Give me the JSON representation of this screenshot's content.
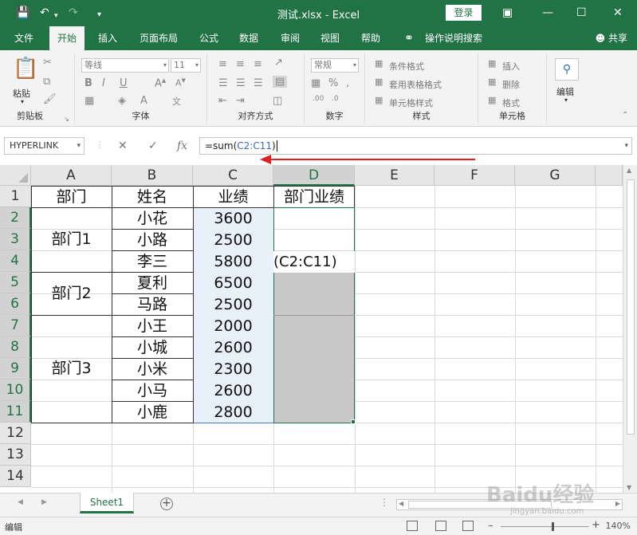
{
  "titlebar": {
    "title": "测试.xlsx  -  Excel",
    "login": "登录",
    "save_icon": "save-icon",
    "undo_icon": "undo-icon",
    "redo_icon": "redo-icon"
  },
  "tabs": [
    {
      "label": "文件"
    },
    {
      "label": "开始"
    },
    {
      "label": "插入"
    },
    {
      "label": "页面布局"
    },
    {
      "label": "公式"
    },
    {
      "label": "数据"
    },
    {
      "label": "审阅"
    },
    {
      "label": "视图"
    },
    {
      "label": "帮助"
    },
    {
      "label": "操作说明搜索"
    }
  ],
  "share": "共享",
  "ribbon": {
    "clipboard": {
      "label": "剪贴板",
      "paste": "粘贴"
    },
    "font": {
      "label": "字体",
      "font_name": "等线",
      "font_size": "11"
    },
    "alignment": {
      "label": "对齐方式"
    },
    "number": {
      "label": "数字",
      "format": "常规"
    },
    "styles": {
      "label": "样式",
      "conditional": "条件格式",
      "table": "套用表格格式",
      "cell": "单元格样式"
    },
    "cells": {
      "label": "单元格",
      "insert": "插入",
      "delete": "删除",
      "format": "格式"
    },
    "editing": {
      "label": "编辑"
    }
  },
  "formula_bar": {
    "name_box": "HYPERLINK",
    "formula_prefix": "=sum(",
    "formula_ref": "C2:C11",
    "formula_suffix": ")"
  },
  "grid": {
    "columns": [
      "A",
      "B",
      "C",
      "D",
      "E",
      "F",
      "G"
    ],
    "rows": [
      "1",
      "2",
      "3",
      "4",
      "5",
      "6",
      "7",
      "8",
      "9",
      "10",
      "11",
      "12",
      "13",
      "14"
    ],
    "headers": {
      "a": "部门",
      "b": "姓名",
      "c": "业绩",
      "d": "部门业绩"
    },
    "departments": [
      "部门1",
      "部门2",
      "部门3"
    ],
    "names": [
      "小花",
      "小路",
      "李三",
      "夏利",
      "马路",
      "小王",
      "小城",
      "小米",
      "小马",
      "小鹿"
    ],
    "scores": [
      "3600",
      "2500",
      "5800",
      "6500",
      "2500",
      "2000",
      "2600",
      "2300",
      "2600",
      "2800"
    ],
    "d4_text": "(C2:C11)"
  },
  "sheet": {
    "name": "Sheet1"
  },
  "status": {
    "mode": "编辑",
    "zoom": "140%"
  },
  "watermark": {
    "main": "Baidu经验",
    "sub": "jingyan.baidu.com"
  }
}
